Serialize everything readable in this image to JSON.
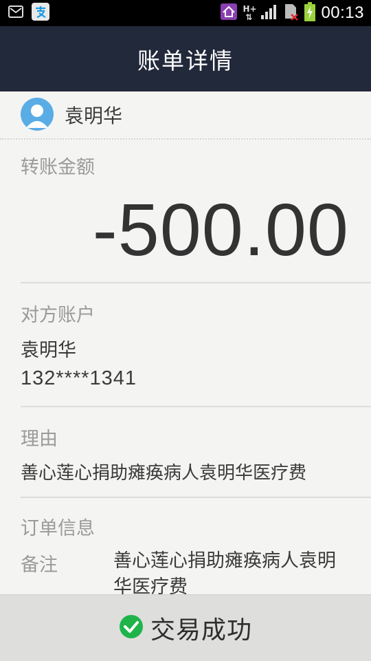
{
  "status_bar": {
    "time": "00:13",
    "network": "H+"
  },
  "header": {
    "title": "账单详情"
  },
  "payee": {
    "name": "袁明华"
  },
  "transfer": {
    "amount_label": "转账金额",
    "amount": "-500.00"
  },
  "counterparty": {
    "label": "对方账户",
    "name": "袁明华",
    "phone": "132****1341"
  },
  "reason": {
    "label": "理由",
    "text": "善心莲心捐助瘫痪病人袁明华医疗费"
  },
  "order_info": {
    "label": "订单信息",
    "note_label": "备注",
    "note_value": "善心莲心捐助瘫痪病人袁明华医疗费"
  },
  "footer": {
    "status": "交易成功"
  },
  "colors": {
    "header_bg": "#22293a",
    "avatar_blue": "#5aace4",
    "success_green": "#1fb44a",
    "label_gray": "#9a9a9a",
    "page_bg": "#f4f4f2"
  }
}
